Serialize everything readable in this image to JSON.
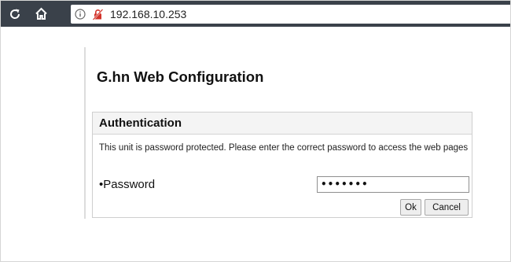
{
  "browser": {
    "url": "192.168.10.253",
    "icons": {
      "reload": "reload-icon",
      "home": "home-icon",
      "info": "info-icon",
      "insecure": "insecure-lock-icon"
    }
  },
  "page": {
    "title": "G.hn Web Configuration"
  },
  "auth": {
    "title": "Authentication",
    "message": "This unit is password protected. Please enter the correct password to access the web pages",
    "password_label": "•Password",
    "password_value": "•••••••",
    "ok_label": "Ok",
    "cancel_label": "Cancel"
  },
  "colors": {
    "toolbar": "#3a414a",
    "insecure_icon": "#d2342b"
  }
}
